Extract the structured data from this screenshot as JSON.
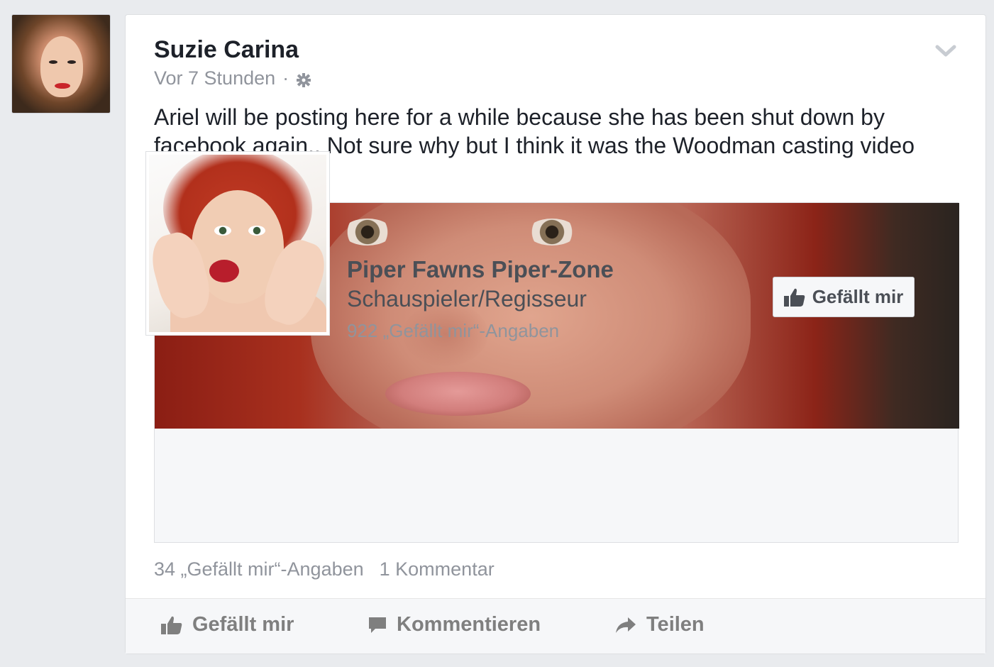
{
  "post": {
    "author": "Suzie Carina",
    "timestamp": "Vor 7 Stunden",
    "separator": "·",
    "text": "Ariel will be posting here for a while because she has been shut down by facebook again.. Not sure why but I think it was the Woodman casting video"
  },
  "shared_page": {
    "name": "Piper Fawns Piper-Zone",
    "category": "Schauspieler/Regisseur",
    "likes": "922 „Gefällt mir“-Angaben",
    "like_button_label": "Gefällt mir"
  },
  "stats": {
    "likes": "34 „Gefällt mir“-Angaben",
    "comments": "1 Kommentar"
  },
  "actions": {
    "like": "Gefällt mir",
    "comment": "Kommentieren",
    "share": "Teilen"
  },
  "icons": {
    "privacy": "gear-icon",
    "options": "chevron-down-icon",
    "like": "thumbs-up-icon",
    "comment": "speech-bubble-icon",
    "share": "share-arrow-icon"
  },
  "colors": {
    "background": "#e9ebee",
    "card": "#ffffff",
    "muted_text": "#90949c",
    "action_text": "#7f7f7f"
  }
}
